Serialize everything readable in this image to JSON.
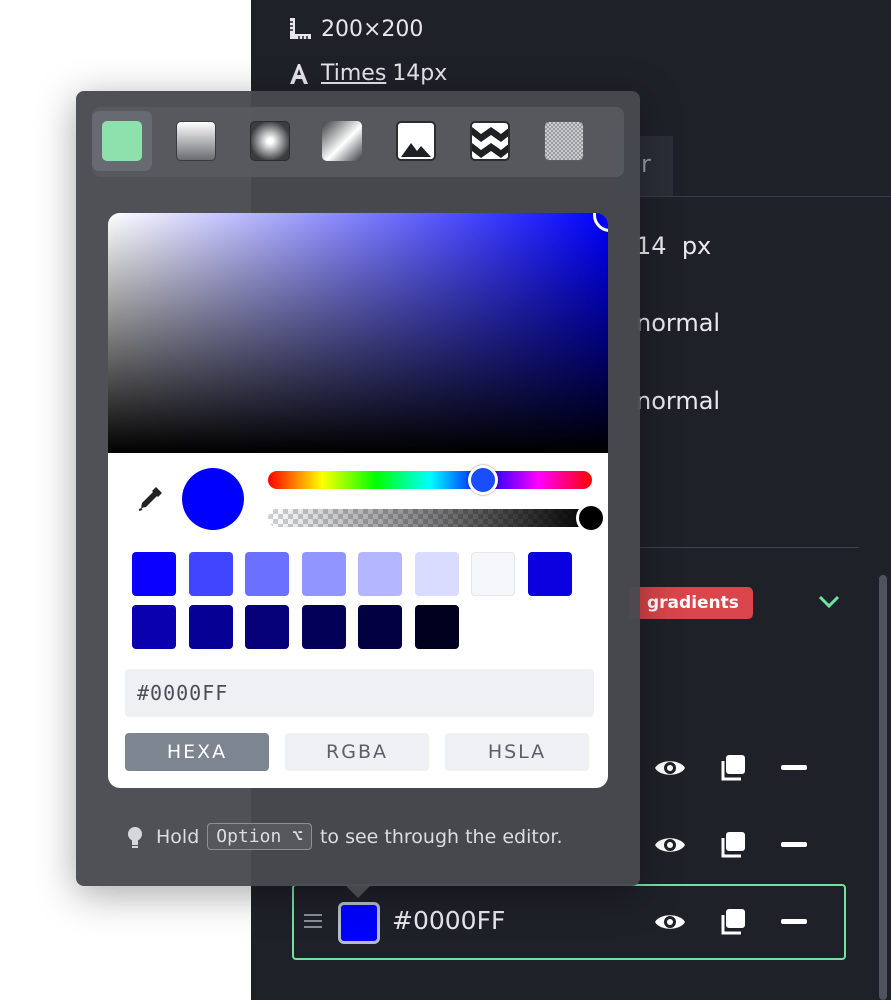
{
  "meta": {
    "dimensions": "200×200",
    "font_family": "Times",
    "font_size": "14px"
  },
  "tab_partial_label": "r",
  "properties": {
    "size_value": "14",
    "size_unit": "px",
    "weight_value": "normal",
    "style_value": "normal"
  },
  "tag_label": "gradients",
  "picker": {
    "fill_types": [
      "solid",
      "linear-gradient",
      "radial-gradient",
      "conic-gradient",
      "image",
      "pattern",
      "noise"
    ],
    "active_fill_type": "solid",
    "current_color": "#0000FF",
    "hex_value": "#0000FF",
    "modes": [
      "HEXA",
      "RGBA",
      "HSLA"
    ],
    "active_mode": "HEXA",
    "swatches_row1": [
      "#0a00ff",
      "#4046ff",
      "#6b70ff",
      "#9095ff",
      "#b4b7ff",
      "#dadcff",
      "#f6f7fb",
      "#0a00e0"
    ],
    "swatches_row2": [
      "#0a00b0",
      "#070095",
      "#050078",
      "#030058",
      "#020040",
      "#01001f"
    ],
    "hint_prefix": "Hold",
    "hint_key": "Option ⌥",
    "hint_suffix": "to see through the editor."
  },
  "layer": {
    "hex": "#0000FF",
    "swatch_color": "#0000ff"
  },
  "colors": {
    "accent_green": "#6fe3a0",
    "tag_red": "#d9454a",
    "panel_dark": "#1f2129"
  }
}
